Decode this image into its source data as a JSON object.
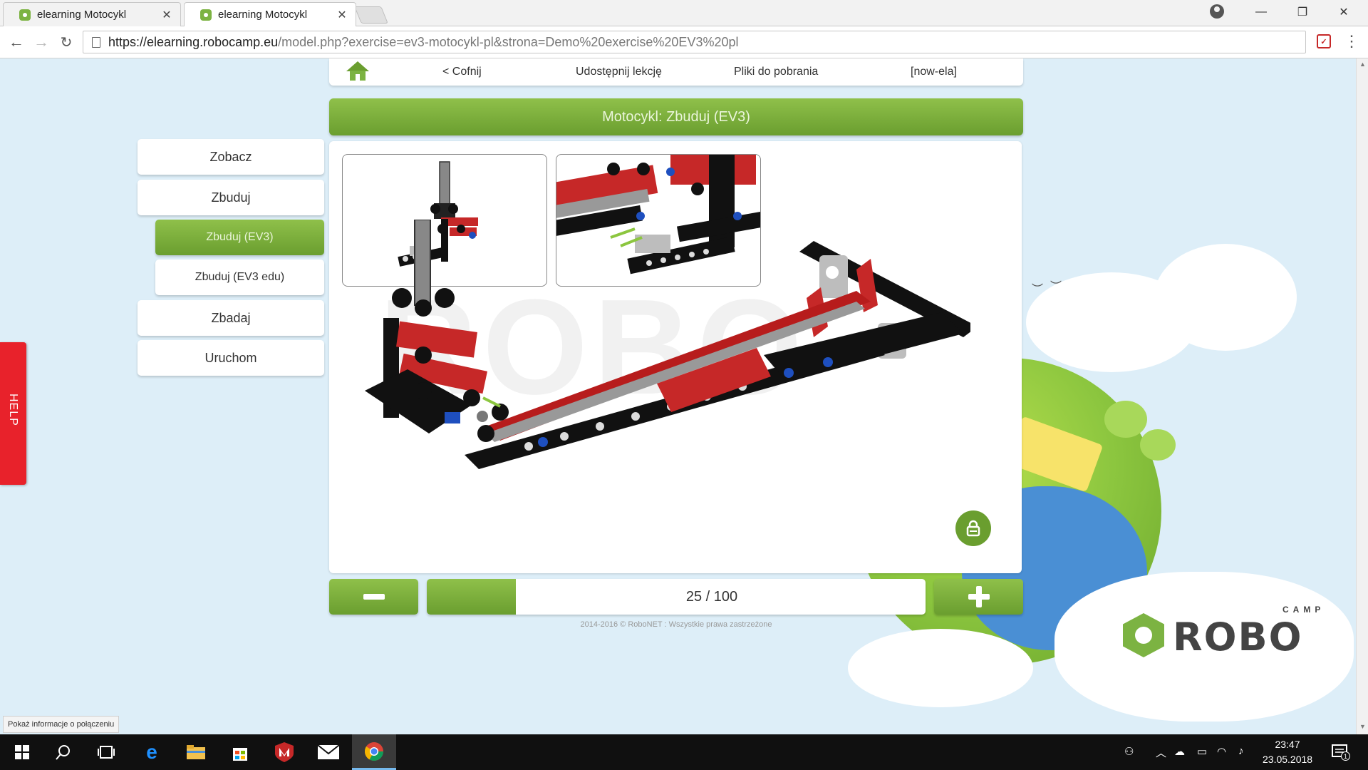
{
  "browser": {
    "tabs": [
      {
        "title": "elearning Motocykl",
        "active": false
      },
      {
        "title": "elearning Motocykl",
        "active": true
      }
    ],
    "url": {
      "host": "https://elearning.robocamp.eu",
      "path": "/model.php?exercise=ev3-motocykl-pl&strona=Demo%20exercise%20EV3%20pl"
    },
    "status_tip": "Pokaż informacje o połączeniu"
  },
  "topnav": {
    "back": "< Cofnij",
    "share": "Udostępnij lekcję",
    "downloads": "Pliki do pobrania",
    "user": "[now-ela]"
  },
  "page_title": "Motocykl: Zbuduj (EV3)",
  "menu": {
    "zobacz": "Zobacz",
    "zbuduj": "Zbuduj",
    "zbuduj_ev3": "Zbuduj (EV3)",
    "zbuduj_ev3_edu": "Zbuduj (EV3 edu)",
    "zbadaj": "Zbadaj",
    "uruchom": "Uruchom"
  },
  "help_label": "HELP",
  "pager": {
    "current": 25,
    "total": 100,
    "label": "25 / 100",
    "progress_fraction": 0.25
  },
  "footer": "2014-2016 © RoboNET : Wszystkie prawa zastrzeżone",
  "logo": {
    "name": "ROBO",
    "sub": "CAMP"
  },
  "watermark": "ROBO",
  "taskbar": {
    "time": "23:47",
    "date": "23.05.2018",
    "notifications": "1"
  }
}
